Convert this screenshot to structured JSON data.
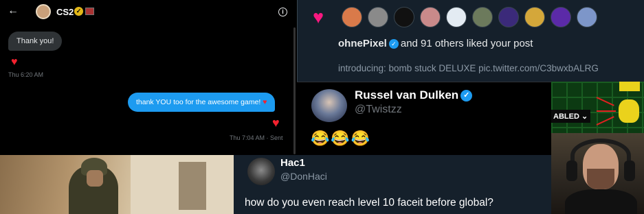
{
  "dm": {
    "back_icon": "←",
    "name": "CS2",
    "info_icon": "i",
    "incoming_message": "Thank you!",
    "incoming_time": "Thu 6:20 AM",
    "outgoing_message": "thank YOU too for the awesome game!",
    "outgoing_status": "Thu 7:04 AM · Sent",
    "reaction_icon": "heart-icon"
  },
  "notification": {
    "icon": "heart-icon",
    "liker_name": "ohnePixel",
    "liked_text": "and 91 others liked your post",
    "post_snippet": "introducing: bomb stuck DELUXE pic.twitter.com/C3bwxbALRG",
    "avatar_colors": [
      "#d97a4a",
      "#8a8a8a",
      "#111111",
      "#c98a8a",
      "#e3ebf2",
      "#6c7a5c",
      "#3b2a7a",
      "#d4a73a",
      "#5b2aa8",
      "#7d96c9"
    ]
  },
  "russel_tweet": {
    "name": "Russel van Dulken",
    "handle": "@Twistzz",
    "text": "😂😂😂"
  },
  "twitch": {
    "label": "ABLED ⌄"
  },
  "hac_tweet": {
    "name": "Hac1",
    "handle": "@DonHaci",
    "text": "how do you even reach level 10 faceit before global?"
  },
  "colors": {
    "verified": "#1d9bf0",
    "like": "#f91880",
    "dm_bubble_out": "#1d9bf0",
    "dim_bg": "#15202b"
  }
}
